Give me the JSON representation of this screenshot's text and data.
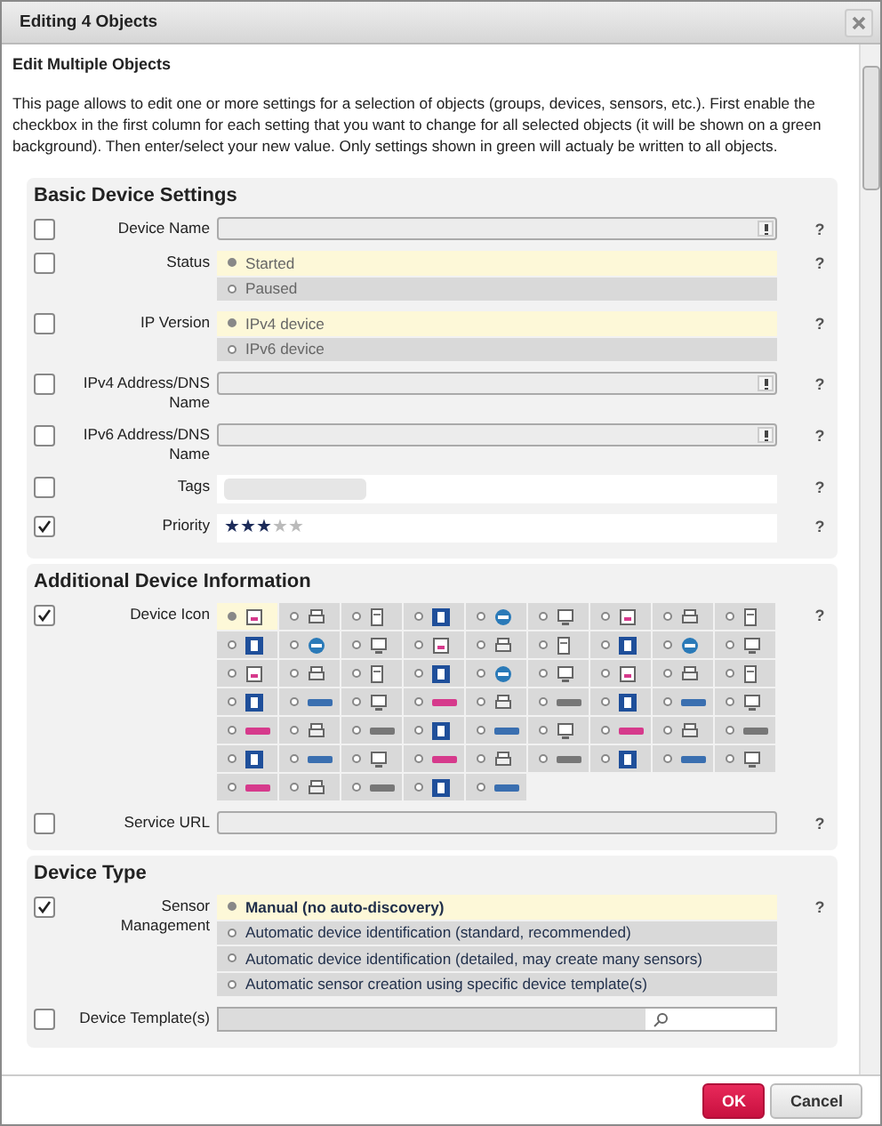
{
  "dialog": {
    "title": "Editing 4 Objects"
  },
  "heading": "Edit Multiple Objects",
  "intro": "This page allows to edit one or more settings for a selection of objects (groups, devices, sensors, etc.). First enable the checkbox in the first column for each setting that you want to change for all selected objects (it will be shown on a green background). Then enter/select your new value. Only settings shown in green will actualy be written to all objects.",
  "sections": [
    {
      "title": "Basic Device Settings",
      "rows": [
        {
          "kind": "text",
          "label": "Device Name",
          "checked": false,
          "help": "?"
        },
        {
          "kind": "radio",
          "label": "Status",
          "checked": false,
          "help": "?",
          "options": [
            {
              "label": "Started",
              "selected": true
            },
            {
              "label": "Paused",
              "selected": false
            }
          ]
        },
        {
          "kind": "radio",
          "label": "IP Version",
          "checked": false,
          "help": "?",
          "options": [
            {
              "label": "IPv4 device",
              "selected": true
            },
            {
              "label": "IPv6 device",
              "selected": false
            }
          ]
        },
        {
          "kind": "text",
          "label": "IPv4 Address/DNS\nName",
          "checked": false,
          "help": "?"
        },
        {
          "kind": "text",
          "label": "IPv6 Address/DNS\nName",
          "checked": false,
          "help": "?"
        },
        {
          "kind": "tags",
          "label": "Tags",
          "checked": false,
          "help": "?"
        },
        {
          "kind": "stars",
          "label": "Priority",
          "checked": true,
          "help": "?",
          "stars": 3
        }
      ]
    },
    {
      "title": "Additional Device Information",
      "rows": [
        {
          "kind": "icons",
          "label": "Device Icon",
          "checked": true,
          "help": "?",
          "icons": [
            {
              "selected": true
            },
            {
              "selected": false
            },
            {
              "selected": false
            },
            {
              "selected": false
            },
            {
              "selected": false
            },
            {
              "selected": false
            },
            {
              "selected": false
            },
            {
              "selected": false
            },
            {
              "selected": false
            },
            {
              "selected": false
            },
            {
              "selected": false
            },
            {
              "selected": false
            },
            {
              "selected": false
            },
            {
              "selected": false
            },
            {
              "selected": false
            },
            {
              "selected": false
            },
            {
              "selected": false
            },
            {
              "selected": false
            },
            {
              "selected": false
            },
            {
              "selected": false
            },
            {
              "selected": false
            },
            {
              "selected": false
            },
            {
              "selected": false
            },
            {
              "selected": false
            },
            {
              "selected": false
            },
            {
              "selected": false
            },
            {
              "selected": false
            },
            {
              "selected": false
            },
            {
              "selected": false
            },
            {
              "selected": false
            },
            {
              "selected": false
            },
            {
              "selected": false
            },
            {
              "selected": false
            },
            {
              "selected": false
            },
            {
              "selected": false
            },
            {
              "selected": false
            },
            {
              "selected": false
            },
            {
              "selected": false
            },
            {
              "selected": false
            },
            {
              "selected": false
            },
            {
              "selected": false
            },
            {
              "selected": false
            },
            {
              "selected": false
            },
            {
              "selected": false
            },
            {
              "selected": false
            },
            {
              "selected": false
            },
            {
              "selected": false
            },
            {
              "selected": false
            },
            {
              "selected": false
            },
            {
              "selected": false
            },
            {
              "selected": false
            },
            {
              "selected": false
            },
            {
              "selected": false
            },
            {
              "selected": false
            },
            {
              "selected": false
            },
            {
              "selected": false
            },
            {
              "selected": false
            },
            {
              "selected": false
            },
            {
              "selected": false
            }
          ]
        },
        {
          "kind": "url",
          "label": "Service URL",
          "checked": false,
          "help": "?"
        }
      ]
    },
    {
      "title": "Device Type",
      "rows": [
        {
          "kind": "radio",
          "label": "Sensor\nManagement",
          "checked": true,
          "help": "?",
          "options": [
            {
              "label": "Manual (no auto-discovery)",
              "selected": true
            },
            {
              "label": "Automatic device identification (standard, recommended)",
              "selected": false
            },
            {
              "label": "Automatic device identification (detailed, may create many sensors)",
              "selected": false
            },
            {
              "label": "Automatic sensor creation using specific device template(s)",
              "selected": false
            }
          ]
        },
        {
          "kind": "search",
          "label": "Device Template(s)",
          "checked": false
        }
      ]
    }
  ],
  "buttons": [
    {
      "label": "OK",
      "kind": "primary"
    },
    {
      "label": "Cancel",
      "kind": "secondary"
    }
  ]
}
